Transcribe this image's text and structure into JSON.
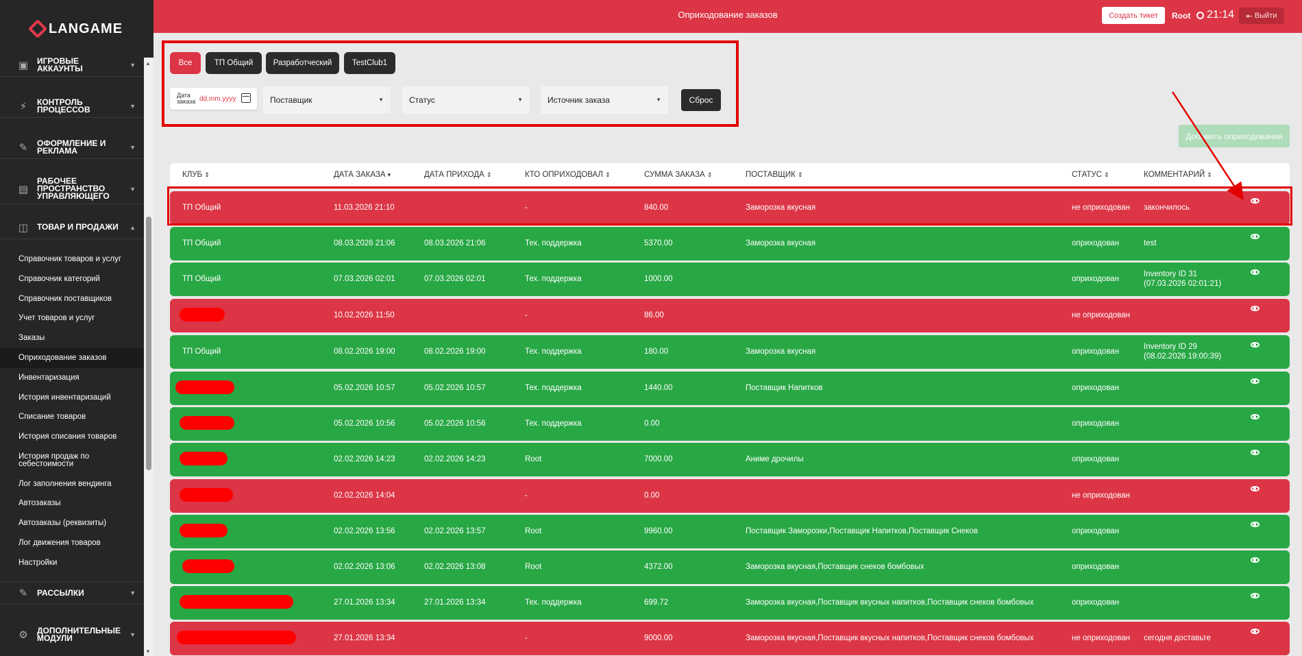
{
  "app": {
    "logo_text": "LANGAME",
    "page_title": "Оприходование заказов"
  },
  "topbar": {
    "ticket_button": "Создать тикет",
    "user": "Root",
    "time": "21:14",
    "exit_button": "Выйти"
  },
  "sidebar": {
    "sections": [
      {
        "label": "ИГРОВЫЕ АККАУНТЫ",
        "icon": "account-icon"
      },
      {
        "label": "КОНТРОЛЬ ПРОЦЕССОВ",
        "icon": "lightning-icon"
      },
      {
        "label": "ОФОРМЛЕНИЕ И РЕКЛАМА",
        "icon": "pencil-icon"
      },
      {
        "label": "РАБОЧЕЕ ПРОСТРАНСТВО УПРАВЛЯЮЩЕГО",
        "icon": "briefcase-icon"
      },
      {
        "label": "ТОВАР И ПРОДАЖИ",
        "icon": "note-icon"
      },
      {
        "label": "РАССЫЛКИ",
        "icon": "pencil-icon"
      },
      {
        "label": "ДОПОЛНИТЕЛЬНЫЕ МОДУЛИ",
        "icon": "gear-icon"
      }
    ],
    "items": [
      "Справочник товаров и услуг",
      "Справочник категорий",
      "Справочник поставщиков",
      "Учет товаров и услуг",
      "Заказы",
      "Оприходование заказов",
      "Инвентаризация",
      "История инвентаризаций",
      "Списание товаров",
      "История списания товаров",
      "История продаж по себестоимости",
      "Лог заполнения вендинга",
      "Автозаказы",
      "Автозаказы (реквизиты)",
      "Лог движения товаров",
      "Настройки"
    ],
    "active_item": "Оприходование заказов"
  },
  "filters": {
    "chips": [
      "Все",
      "ТП Общий",
      "Разработческий",
      "TestClub1"
    ],
    "active_chip": "Все",
    "date_label": "Дата заказа",
    "date_placeholder": "dd.mm.yyyy",
    "supplier": "Поставщик",
    "status": "Статус",
    "source": "Источник заказа",
    "reset_button": "Сброс",
    "add_button": "Добавить оприходования"
  },
  "table": {
    "columns": [
      "КЛУБ",
      "ДАТА ЗАКАЗА",
      "ДАТА ПРИХОДА",
      "КТО ОПРИХОДОВАЛ",
      "СУММА ЗАКАЗА",
      "ПОСТАВЩИК",
      "СТАТУС",
      "КОММЕНТАРИЙ"
    ],
    "rows": [
      {
        "club": "ТП Общий",
        "order_date": "11.03.2026 21:10",
        "arrival_date": "",
        "who": "-",
        "sum": "840.00",
        "supplier": "Заморозка вкусная",
        "status": "не оприходован",
        "comment": "закончилось",
        "state": "red",
        "redacted": false
      },
      {
        "club": "ТП Общий",
        "order_date": "08.03.2026 21:06",
        "arrival_date": "08.03.2026 21:06",
        "who": "Тех. поддержка",
        "sum": "5370.00",
        "supplier": "Заморозка вкусная",
        "status": "оприходован",
        "comment": "test",
        "state": "green",
        "redacted": false
      },
      {
        "club": "ТП Общий",
        "order_date": "07.03.2026 02:01",
        "arrival_date": "07.03.2026 02:01",
        "who": "Тех. поддержка",
        "sum": "1000.00",
        "supplier": "",
        "status": "оприходован",
        "comment": "Inventory ID 31",
        "comment2": "(07.03.2026 02:01:21)",
        "state": "green",
        "redacted": false
      },
      {
        "club": "",
        "order_date": "10.02.2026 11:50",
        "arrival_date": "",
        "who": "-",
        "sum": "86.00",
        "supplier": "",
        "status": "не оприходован",
        "comment": "",
        "state": "red",
        "redacted": true
      },
      {
        "club": "ТП Общий",
        "order_date": "08.02.2026 19:00",
        "arrival_date": "08.02.2026 19:00",
        "who": "Тех. поддержка",
        "sum": "180.00",
        "supplier": "Заморозка вкусная",
        "status": "оприходован",
        "comment": "Inventory ID 29",
        "comment2": "(08.02.2026 19:00:39)",
        "state": "green",
        "redacted": false
      },
      {
        "club": "",
        "order_date": "05.02.2026 10:57",
        "arrival_date": "05.02.2026 10:57",
        "who": "Тех. поддержка",
        "sum": "1440.00",
        "supplier": "Поставщик Напитков",
        "status": "оприходован",
        "comment": "",
        "state": "green",
        "redacted": true
      },
      {
        "club": "",
        "order_date": "05.02.2026 10:56",
        "arrival_date": "05.02.2026 10:56",
        "who": "Тех. поддержка",
        "sum": "0.00",
        "supplier": "",
        "status": "оприходован",
        "comment": "",
        "state": "green",
        "redacted": true
      },
      {
        "club": "",
        "order_date": "02.02.2026 14:23",
        "arrival_date": "02.02.2026 14:23",
        "who": "Root",
        "sum": "7000.00",
        "supplier": "Аниме дрочилы",
        "status": "оприходован",
        "comment": "",
        "state": "green",
        "redacted": true
      },
      {
        "club": "",
        "order_date": "02.02.2026 14:04",
        "arrival_date": "",
        "who": "-",
        "sum": "0.00",
        "supplier": "",
        "status": "не оприходован",
        "comment": "",
        "state": "red",
        "redacted": true
      },
      {
        "club": "",
        "order_date": "02.02.2026 13:56",
        "arrival_date": "02.02.2026 13:57",
        "who": "Root",
        "sum": "9960.00",
        "supplier": "Поставщик Заморозки,Поставщик Напитков,Поставщик Снеков",
        "status": "оприходован",
        "comment": "",
        "state": "green",
        "redacted": true
      },
      {
        "club": "",
        "order_date": "02.02.2026 13:06",
        "arrival_date": "02.02.2026 13:08",
        "who": "Root",
        "sum": "4372.00",
        "supplier": "Заморозка вкусная,Поставщик снеков бомбовых",
        "status": "оприходован",
        "comment": "",
        "state": "green",
        "redacted": true
      },
      {
        "club": "",
        "order_date": "27.01.2026 13:34",
        "arrival_date": "27.01.2026 13:34",
        "who": "Тех. поддержка",
        "sum": "699.72",
        "supplier": "Заморозка вкусная,Поставщик вкусных напитков,Поставщик снеков бомбовых",
        "status": "оприходован",
        "comment": "",
        "state": "green",
        "redacted": true
      },
      {
        "club": "",
        "order_date": "27.01.2026 13:34",
        "arrival_date": "",
        "who": "-",
        "sum": "9000.00",
        "supplier": "Заморозка вкусная,Поставщик вкусных напитков,Поставщик снеков бомбовых",
        "status": "не оприходован",
        "comment": "сегодня доставьте",
        "state": "red",
        "redacted": true
      }
    ]
  },
  "colors": {
    "accent": "#dc3545",
    "success": "#28a745",
    "sidebar": "#262626",
    "annotation": "#e30000"
  }
}
